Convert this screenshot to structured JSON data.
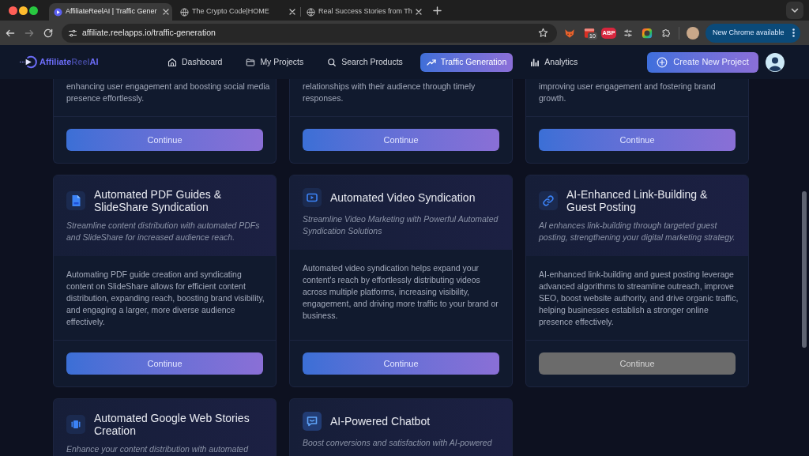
{
  "browser": {
    "tabs": [
      {
        "title": "AffiliateReelAI | Traffic Gener",
        "selected": true
      },
      {
        "title": "The Crypto Code|HOME",
        "selected": false
      },
      {
        "title": "Real Success Stories from Th",
        "selected": false
      }
    ],
    "url": "affiliate.reelapps.io/traffic-generation",
    "extension_badge": "10",
    "adblock_label": "ABP",
    "update_button": "New Chrome available"
  },
  "nav": {
    "logo": "**Affiliate**Reel**AI**",
    "items": [
      {
        "label": "Dashboard",
        "selected": false
      },
      {
        "label": "My Projects",
        "selected": false
      },
      {
        "label": "Search Products",
        "selected": false
      },
      {
        "label": "Traffic Generation",
        "selected": true
      },
      {
        "label": "Analytics",
        "selected": false
      }
    ],
    "create_button": "Create New Project"
  },
  "cards": [
    {
      "description": "enhancing user engagement and boosting social media presence effortlessly.",
      "button": {
        "label": "Continue",
        "disabled": false
      }
    },
    {
      "description": "relationships with their audience through timely responses.",
      "button": {
        "label": "Continue",
        "disabled": false
      }
    },
    {
      "description": "improving user engagement and fostering brand growth.",
      "button": {
        "label": "Continue",
        "disabled": false
      }
    },
    {
      "title": "Automated PDF Guides & SlideShare Syndication",
      "subtitle": "Streamline content distribution with automated PDFs and SlideShare for increased audience reach.",
      "description": "Automating PDF guide creation and syndicating content on SlideShare allows for efficient content distribution, expanding reach, boosting brand visibility, and engaging a larger, more diverse audience effectively.",
      "button": {
        "label": "Continue",
        "disabled": false
      }
    },
    {
      "title": "Automated Video Syndication",
      "subtitle": "Streamline Video Marketing with Powerful Automated Syndication Solutions",
      "description": "Automated video syndication helps expand your content's reach by effortlessly distributing videos across multiple platforms, increasing visibility, engagement, and driving more traffic to your brand or business.",
      "button": {
        "label": "Continue",
        "disabled": false
      }
    },
    {
      "title": "AI-Enhanced Link-Building & Guest Posting",
      "subtitle": "AI enhances link-building through targeted guest posting, strengthening your digital marketing strategy.",
      "description": "AI-enhanced link-building and guest posting leverage advanced algorithms to streamline outreach, improve SEO, boost website authority, and drive organic traffic, helping businesses establish a stronger online presence effectively.",
      "button": {
        "label": "Continue",
        "disabled": true
      }
    },
    {
      "title": "Automated Google Web Stories Creation",
      "subtitle": "Enhance your content distribution with automated"
    },
    {
      "title": "AI-Powered Chatbot",
      "subtitle": "Boost conversions and satisfaction with AI-powered"
    }
  ]
}
